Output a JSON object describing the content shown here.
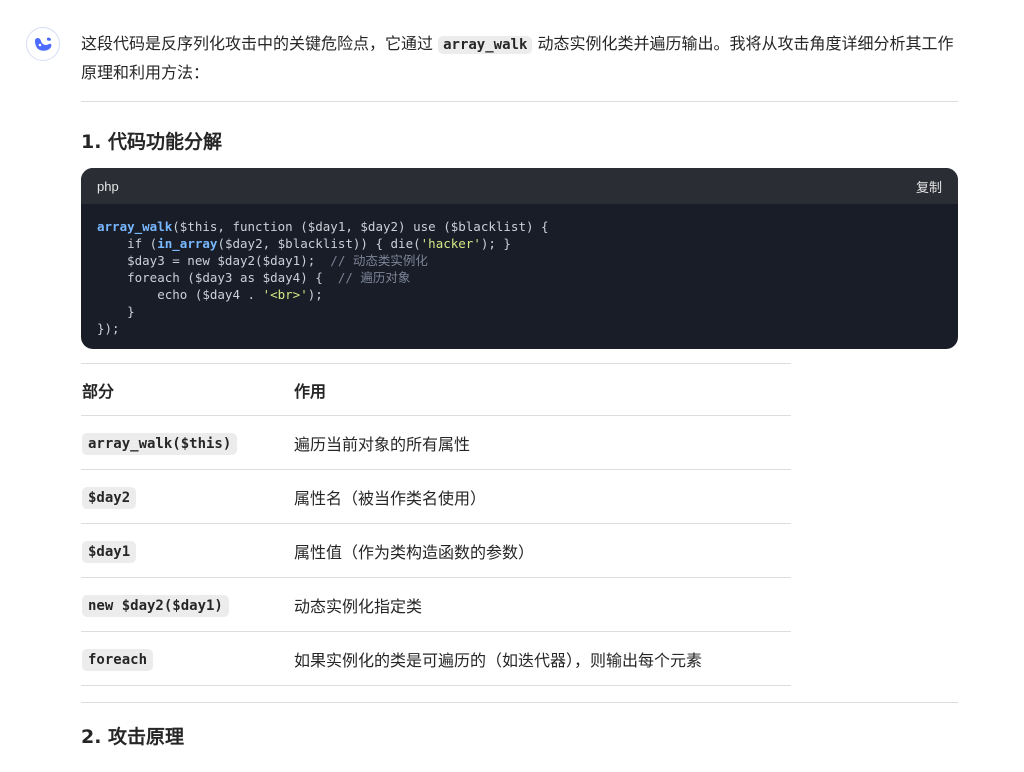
{
  "assistant": {
    "avatar_icon": "whale-logo-icon",
    "accent": "#4d6bfe"
  },
  "intro": {
    "part1": "这段代码是反序列化攻击中的关键危险点，它通过 ",
    "code": "array_walk",
    "part2": " 动态实例化类并遍历输出。我将从攻击角度详细分析其工作原理和利用方法："
  },
  "section1": {
    "title": "1. 代码功能分解"
  },
  "code_block": {
    "language": "php",
    "copy_label": "复制",
    "lines": [
      "array_walk($this, function ($day1, $day2) use ($blacklist) {",
      "    if (in_array($day2, $blacklist)) { die('hacker'); }",
      "    $day3 = new $day2($day1);  // 动态类实例化",
      "    foreach ($day3 as $day4) {  // 遍历对象",
      "        echo ($day4 . '<br>');",
      "    }",
      "});"
    ]
  },
  "table": {
    "headers": [
      "部分",
      "作用"
    ],
    "rows": [
      {
        "part": "array_walk($this)",
        "role": "遍历当前对象的所有属性"
      },
      {
        "part": "$day2",
        "role": "属性名（被当作类名使用）"
      },
      {
        "part": "$day1",
        "role": "属性值（作为类构造函数的参数）"
      },
      {
        "part": "new $day2($day1)",
        "role": "动态实例化指定类"
      },
      {
        "part": "foreach",
        "role": "如果实例化的类是可遍历的（如迭代器），则输出每个元素"
      }
    ]
  },
  "section2": {
    "title": "2. 攻击原理"
  }
}
